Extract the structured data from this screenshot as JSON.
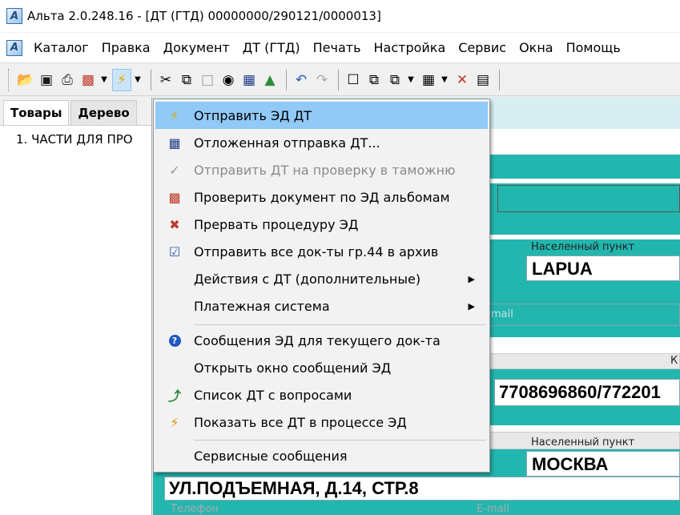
{
  "window": {
    "title": "Альта 2.0.248.16 - [ДТ (ГТД) 00000000/290121/0000013]",
    "app_icon": "alta-app-icon"
  },
  "menubar": [
    "Каталог",
    "Правка",
    "Документ",
    "ДТ (ГТД)",
    "Печать",
    "Настройка",
    "Сервис",
    "Окна",
    "Помощь"
  ],
  "left_panel": {
    "tabs": [
      "Товары",
      "Дерево"
    ],
    "tree_item": "1. ЧАСТИ ДЛЯ ПРО"
  },
  "form": {
    "label_settlement": "Населенный пункт",
    "value_lapua": "LAPUA",
    "label_email_partial": "mail",
    "label_k": "К",
    "value_inn": "7708696860/772201",
    "value_moscow": "МОСКВА",
    "value_address": "УЛ.ПОДЪЕМНАЯ, Д.14, СТР.8",
    "label_phone": "Телефон",
    "label_email": "E-mail"
  },
  "dropdown": {
    "items": [
      {
        "label": "Отправить ЭД ДТ",
        "icon": "lightning-icon",
        "selected": true
      },
      {
        "label": "Отложенная отправка ДТ...",
        "icon": "deferred-send-icon"
      },
      {
        "label": "Отправить ДТ на проверку в таможню",
        "icon": "check-disabled-icon",
        "disabled": true
      },
      {
        "label": "Проверить документ по ЭД альбомам",
        "icon": "xml-check-icon"
      },
      {
        "label": "Прервать процедуру ЭД",
        "icon": "cancel-doc-icon"
      },
      {
        "label": "Отправить все док-ты гр.44 в архив",
        "icon": "archive-check-icon"
      },
      {
        "label": "Действия с ДТ (дополнительные)",
        "submenu": true
      },
      {
        "label": "Платежная система",
        "submenu": true
      },
      {
        "label": "Сообщения ЭД для текущего док-та",
        "icon": "help-icon"
      },
      {
        "label": "Открыть окно сообщений ЭД"
      },
      {
        "label": "Список ДТ с вопросами",
        "icon": "green-arrow-icon"
      },
      {
        "label": "Показать все ДТ в процессе ЭД",
        "icon": "process-icon"
      },
      {
        "label": "Сервисные сообщения"
      }
    ]
  }
}
